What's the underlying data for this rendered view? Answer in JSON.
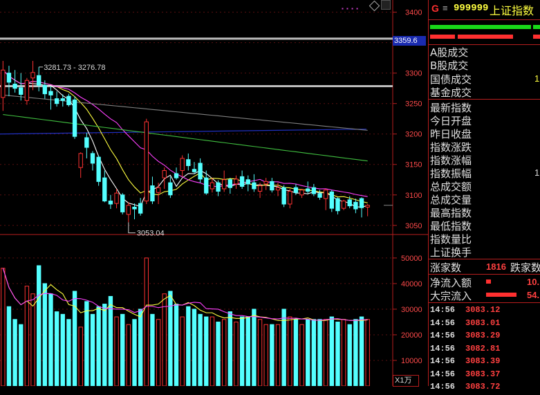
{
  "header": {
    "g_label": "G",
    "menu_icon": "menu-icon",
    "code": "999999",
    "name": "上证指数",
    "pink_dots": "▪ ▪ ▪ ▪",
    "diamond_icon": "diamond-icon"
  },
  "left_tags": {
    "current_price": "3359.6"
  },
  "price_axis": [
    "3400",
    "3350",
    "3300",
    "3250",
    "3200",
    "3150",
    "3100",
    "3050"
  ],
  "volume_axis": [
    "50000",
    "40000",
    "30000",
    "20000",
    "10000"
  ],
  "volume_unit": "X1万",
  "annotations": {
    "range": "3281.73 - 3276.78",
    "low": "3053.04"
  },
  "side_labels": {
    "a_turnover": "A股成交",
    "b_turnover": "B股成交",
    "bond_turnover": "国债成交",
    "fund_turnover": "基金成交",
    "latest": "最新指数",
    "open": "今日开盘",
    "prev_close": "昨日收盘",
    "change": "指数涨跌",
    "change_pct": "指数涨幅",
    "amplitude": "指数振幅",
    "total_amount": "总成交额",
    "total_volume": "总成交量",
    "high": "最高指数",
    "low": "最低指数",
    "volume_ratio": "指数量比",
    "turnover_rate": "上证换手"
  },
  "side_values": {
    "bond_turnover_frag": "1",
    "amplitude_frag": "1"
  },
  "breadth": {
    "up_label": "涨家数",
    "up_value": "1816",
    "down_label": "跌家数"
  },
  "flows": {
    "net_inflow_label": "净流入额",
    "net_inflow_value": "10.",
    "block_inflow_label": "大宗流入",
    "block_inflow_value": "54."
  },
  "ticks": [
    {
      "time": "14:56",
      "price": "3083.12"
    },
    {
      "time": "14:56",
      "price": "3083.01"
    },
    {
      "time": "14:56",
      "price": "3083.29"
    },
    {
      "time": "14:56",
      "price": "3082.81"
    },
    {
      "time": "14:56",
      "price": "3083.39"
    },
    {
      "time": "14:56",
      "price": "3083.37"
    },
    {
      "time": "14:56",
      "price": "3083.72"
    }
  ],
  "chart_data": {
    "type": "candlestick",
    "ylim": [
      3035,
      3420
    ],
    "volume_ylim": [
      0,
      57000
    ],
    "hlines": [
      3356,
      3278
    ],
    "candles": [
      {
        "o": 3260,
        "h": 3320,
        "l": 3238,
        "c": 3305,
        "v": 46000
      },
      {
        "o": 3300,
        "h": 3312,
        "l": 3262,
        "c": 3285,
        "v": 31000
      },
      {
        "o": 3282,
        "h": 3305,
        "l": 3268,
        "c": 3275,
        "v": 26000
      },
      {
        "o": 3276,
        "h": 3300,
        "l": 3255,
        "c": 3265,
        "v": 24000
      },
      {
        "o": 3255,
        "h": 3292,
        "l": 3248,
        "c": 3288,
        "v": 39000
      },
      {
        "o": 3292,
        "h": 3320,
        "l": 3272,
        "c": 3301,
        "v": 36000
      },
      {
        "o": 3296,
        "h": 3310,
        "l": 3270,
        "c": 3280,
        "v": 47000
      },
      {
        "o": 3280,
        "h": 3288,
        "l": 3258,
        "c": 3266,
        "v": 40000
      },
      {
        "o": 3270,
        "h": 3278,
        "l": 3240,
        "c": 3264,
        "v": 36000
      },
      {
        "o": 3258,
        "h": 3270,
        "l": 3245,
        "c": 3250,
        "v": 29000
      },
      {
        "o": 3258,
        "h": 3265,
        "l": 3245,
        "c": 3255,
        "v": 28000
      },
      {
        "o": 3262,
        "h": 3266,
        "l": 3245,
        "c": 3248,
        "v": 26000
      },
      {
        "o": 3256,
        "h": 3262,
        "l": 3192,
        "c": 3196,
        "v": 37000
      },
      {
        "o": 3145,
        "h": 3170,
        "l": 3128,
        "c": 3168,
        "v": 23000
      },
      {
        "o": 3194,
        "h": 3202,
        "l": 3160,
        "c": 3178,
        "v": 33000
      },
      {
        "o": 3168,
        "h": 3172,
        "l": 3140,
        "c": 3152,
        "v": 28000
      },
      {
        "o": 3162,
        "h": 3165,
        "l": 3115,
        "c": 3122,
        "v": 31000
      },
      {
        "o": 3128,
        "h": 3140,
        "l": 3088,
        "c": 3090,
        "v": 32000
      },
      {
        "o": 3090,
        "h": 3100,
        "l": 3077,
        "c": 3085,
        "v": 35000
      },
      {
        "o": 3086,
        "h": 3110,
        "l": 3078,
        "c": 3103,
        "v": 27000
      },
      {
        "o": 3100,
        "h": 3103,
        "l": 3068,
        "c": 3072,
        "v": 28000
      },
      {
        "o": 3068,
        "h": 3088,
        "l": 3055,
        "c": 3083,
        "v": 24000
      },
      {
        "o": 3080,
        "h": 3086,
        "l": 3060,
        "c": 3077,
        "v": 26000
      },
      {
        "o": 3086,
        "h": 3095,
        "l": 3066,
        "c": 3070,
        "v": 30000
      },
      {
        "o": 3090,
        "h": 3225,
        "l": 3085,
        "c": 3220,
        "v": 50000
      },
      {
        "o": 3115,
        "h": 3130,
        "l": 3085,
        "c": 3090,
        "v": 28000
      },
      {
        "o": 3104,
        "h": 3120,
        "l": 3085,
        "c": 3112,
        "v": 26000
      },
      {
        "o": 3128,
        "h": 3145,
        "l": 3110,
        "c": 3140,
        "v": 36000
      },
      {
        "o": 3120,
        "h": 3130,
        "l": 3095,
        "c": 3100,
        "v": 37000
      },
      {
        "o": 3135,
        "h": 3145,
        "l": 3125,
        "c": 3128,
        "v": 32000
      },
      {
        "o": 3140,
        "h": 3165,
        "l": 3130,
        "c": 3160,
        "v": 27000
      },
      {
        "o": 3158,
        "h": 3168,
        "l": 3140,
        "c": 3148,
        "v": 31000
      },
      {
        "o": 3142,
        "h": 3154,
        "l": 3135,
        "c": 3138,
        "v": 30000
      },
      {
        "o": 3152,
        "h": 3160,
        "l": 3120,
        "c": 3126,
        "v": 28000
      },
      {
        "o": 3128,
        "h": 3140,
        "l": 3100,
        "c": 3103,
        "v": 27000
      },
      {
        "o": 3110,
        "h": 3128,
        "l": 3104,
        "c": 3120,
        "v": 27000
      },
      {
        "o": 3120,
        "h": 3124,
        "l": 3098,
        "c": 3106,
        "v": 25000
      },
      {
        "o": 3110,
        "h": 3140,
        "l": 3105,
        "c": 3125,
        "v": 26000
      },
      {
        "o": 3125,
        "h": 3128,
        "l": 3102,
        "c": 3112,
        "v": 29000
      },
      {
        "o": 3118,
        "h": 3132,
        "l": 3110,
        "c": 3126,
        "v": 25000
      },
      {
        "o": 3130,
        "h": 3140,
        "l": 3110,
        "c": 3114,
        "v": 27000
      },
      {
        "o": 3125,
        "h": 3132,
        "l": 3106,
        "c": 3118,
        "v": 27000
      },
      {
        "o": 3120,
        "h": 3134,
        "l": 3105,
        "c": 3110,
        "v": 30000
      },
      {
        "o": 3106,
        "h": 3120,
        "l": 3095,
        "c": 3115,
        "v": 26000
      },
      {
        "o": 3118,
        "h": 3128,
        "l": 3108,
        "c": 3122,
        "v": 24000
      },
      {
        "o": 3122,
        "h": 3128,
        "l": 3104,
        "c": 3108,
        "v": 24000
      },
      {
        "o": 3108,
        "h": 3120,
        "l": 3098,
        "c": 3112,
        "v": 24000
      },
      {
        "o": 3112,
        "h": 3116,
        "l": 3080,
        "c": 3085,
        "v": 30000
      },
      {
        "o": 3085,
        "h": 3110,
        "l": 3078,
        "c": 3106,
        "v": 27000
      },
      {
        "o": 3112,
        "h": 3118,
        "l": 3100,
        "c": 3104,
        "v": 26000
      },
      {
        "o": 3100,
        "h": 3110,
        "l": 3095,
        "c": 3108,
        "v": 24000
      },
      {
        "o": 3110,
        "h": 3122,
        "l": 3102,
        "c": 3106,
        "v": 26000
      },
      {
        "o": 3112,
        "h": 3118,
        "l": 3098,
        "c": 3102,
        "v": 26000
      },
      {
        "o": 3102,
        "h": 3108,
        "l": 3092,
        "c": 3096,
        "v": 26000
      },
      {
        "o": 3094,
        "h": 3110,
        "l": 3075,
        "c": 3108,
        "v": 26000
      },
      {
        "o": 3105,
        "h": 3108,
        "l": 3072,
        "c": 3078,
        "v": 27000
      },
      {
        "o": 3094,
        "h": 3096,
        "l": 3068,
        "c": 3074,
        "v": 25000
      },
      {
        "o": 3078,
        "h": 3092,
        "l": 3075,
        "c": 3090,
        "v": 26000
      },
      {
        "o": 3092,
        "h": 3098,
        "l": 3078,
        "c": 3082,
        "v": 24000
      },
      {
        "o": 3088,
        "h": 3094,
        "l": 3070,
        "c": 3077,
        "v": 26000
      },
      {
        "o": 3094,
        "h": 3096,
        "l": 3063,
        "c": 3079,
        "v": 27000
      },
      {
        "o": 3080,
        "h": 3085,
        "l": 3065,
        "c": 3083,
        "v": 26000
      }
    ]
  }
}
